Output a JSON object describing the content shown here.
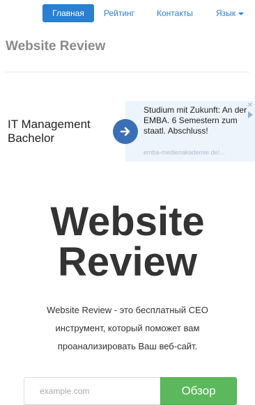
{
  "nav": {
    "home": "Главная",
    "rating": "Рейтинг",
    "contacts": "Контакты",
    "language": "Язык"
  },
  "brand": "Website Review",
  "ad": {
    "title": "IT Management Bachelor",
    "text": "Studium mit Zukunft: An der EMBA. 6 Semestern zum staatl. Abschluss!",
    "url": "emba-medienakademie.de/...",
    "close_icon": "close-icon",
    "adchoices_icon": "play-icon"
  },
  "hero": {
    "title_line1": "Website",
    "title_line2": "Review",
    "desc_line1": "Website Review - это бесплатный СЕО",
    "desc_line2": "инструмент, который поможет вам",
    "desc_line3": "проанализировать Ваш веб-сайт."
  },
  "search": {
    "placeholder": "example.com",
    "button": "Обзор"
  },
  "colors": {
    "accent": "#2a7fd0",
    "button_green": "#5cb85c",
    "ad_button": "#3b6fb5"
  }
}
